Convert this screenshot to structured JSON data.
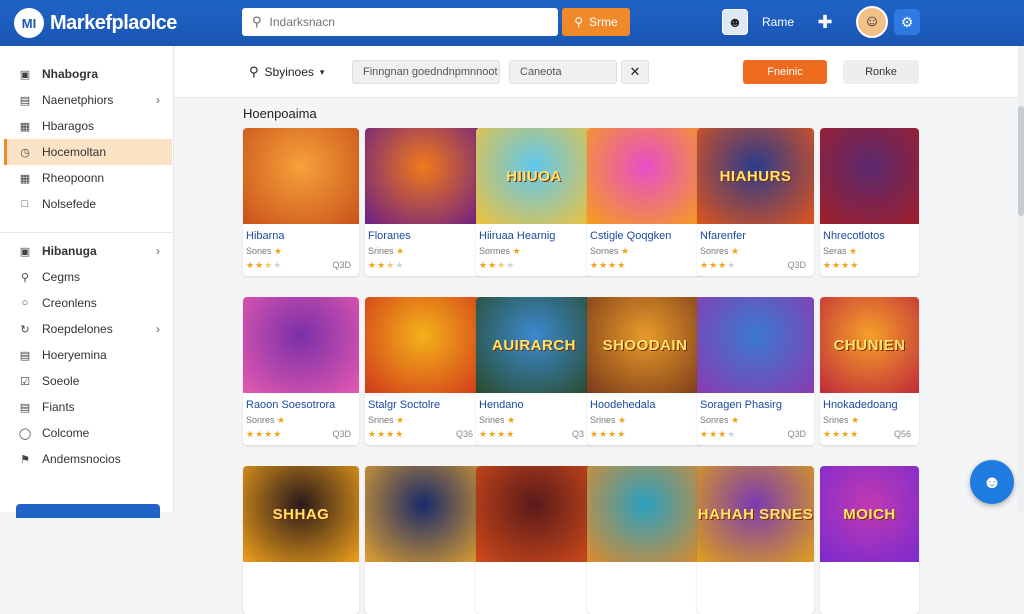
{
  "app": {
    "logo_mark": "MI",
    "name": "Markefplaolce"
  },
  "topbar": {
    "search_placeholder": "Indarksnacn",
    "search_button": "Srme",
    "user_name": "Rame",
    "plus_icon": "plus-icon",
    "settings_icon": "settings-icon"
  },
  "sidebar": {
    "group1": [
      {
        "label": "Nhabogra",
        "icon": "home-icon",
        "bold": true
      },
      {
        "label": "Naenetphiors",
        "icon": "list-icon",
        "chevron": true
      },
      {
        "label": "Hbaragos",
        "icon": "grid-icon"
      },
      {
        "label": "Hocemoltan",
        "icon": "clock-icon",
        "active": true
      },
      {
        "label": "Rheopoonn",
        "icon": "tag-icon"
      },
      {
        "label": "Nolsefede",
        "icon": "page-icon"
      }
    ],
    "group2": [
      {
        "label": "Hibanuga",
        "icon": "box-icon",
        "bold": true,
        "chevron": true
      },
      {
        "label": "Cegms",
        "icon": "search-icon"
      },
      {
        "label": "Creonlens",
        "icon": "user-icon"
      },
      {
        "label": "Roepdelones",
        "icon": "refresh-icon",
        "chevron": true
      },
      {
        "label": "Hoeryemina",
        "icon": "chat-icon"
      },
      {
        "label": "Soeole",
        "icon": "check-icon"
      },
      {
        "label": "Fiants",
        "icon": "doc-icon"
      },
      {
        "label": "Colcome",
        "icon": "circle-icon"
      },
      {
        "label": "Andemsnocios",
        "icon": "flag-icon"
      }
    ]
  },
  "filterbar": {
    "sort_label": "Sbyinoes",
    "field1": "Finngnan goedndnpmnnoot",
    "field2": "Caneota",
    "primary_button": "Fneinic",
    "secondary_button": "Ronke"
  },
  "section_title": "Hoenpoaima",
  "cards": [
    {
      "title": "Hibarna",
      "sub": "Sones",
      "rating": 2.5,
      "count": "Q3D",
      "thumb_text": "",
      "colors": [
        "#f6a23a",
        "#c9521a"
      ]
    },
    {
      "title": "Floranes",
      "sub": "Srines",
      "rating": 2.5,
      "count": "",
      "thumb_text": "",
      "colors": [
        "#f07a1a",
        "#6b1e86"
      ]
    },
    {
      "title": "Hiiruaa Hearnig",
      "sub": "Sormes",
      "rating": 2.5,
      "count": "",
      "thumb_text": "HIIUOA",
      "colors": [
        "#5ec7f0",
        "#f1c23a"
      ]
    },
    {
      "title": "Cstigle Qoqgken",
      "sub": "Sornes",
      "rating": 4,
      "count": "",
      "thumb_text": "",
      "colors": [
        "#e84ec8",
        "#f5a01a"
      ]
    },
    {
      "title": "Nfarenfer",
      "sub": "Sonres",
      "rating": 3,
      "count": "Q3D",
      "thumb_text": "HIAHURS",
      "colors": [
        "#2a3b8c",
        "#e0541b"
      ]
    },
    {
      "title": "Nhrecotlotos",
      "sub": "Seras",
      "rating": 4,
      "count": "",
      "thumb_text": "",
      "colors": [
        "#5a2a70",
        "#a01e2a"
      ]
    },
    {
      "title": "Raoon Soesotrora",
      "sub": "Sonres",
      "rating": 4,
      "count": "Q3D",
      "thumb_text": "",
      "colors": [
        "#7a2fa8",
        "#e45ab0"
      ]
    },
    {
      "title": "Stalgr Soctolre",
      "sub": "Srines",
      "rating": 4,
      "count": "Q36",
      "thumb_text": "",
      "colors": [
        "#f5b21a",
        "#d0391a"
      ]
    },
    {
      "title": "Hendano",
      "sub": "Srines",
      "rating": 4,
      "count": "Q3",
      "thumb_text": "AUIRARCH",
      "colors": [
        "#3a8ad0",
        "#2a4a2a"
      ]
    },
    {
      "title": "Hoodehedala",
      "sub": "Srines",
      "rating": 4,
      "count": "",
      "thumb_text": "SHOODAIN",
      "colors": [
        "#e89a2a",
        "#7a3a1a"
      ]
    },
    {
      "title": "Soragen Phasirg",
      "sub": "Sonres",
      "rating": 3,
      "count": "Q3D",
      "thumb_text": "",
      "colors": [
        "#3a7ad0",
        "#8a3ab0"
      ]
    },
    {
      "title": "Hnokadedoang",
      "sub": "Srines",
      "rating": 4,
      "count": "Q56",
      "thumb_text": "CHUNIEN",
      "colors": [
        "#f5a02a",
        "#c02a3a"
      ]
    },
    {
      "title": "",
      "sub": "",
      "rating": 0,
      "count": "",
      "thumb_text": "SHHAG",
      "colors": [
        "#2a1a1a",
        "#f0a01a"
      ]
    },
    {
      "title": "",
      "sub": "",
      "rating": 0,
      "count": "",
      "thumb_text": "",
      "colors": [
        "#1a2a6a",
        "#e0a030"
      ]
    },
    {
      "title": "",
      "sub": "",
      "rating": 0,
      "count": "",
      "thumb_text": "",
      "colors": [
        "#5a1a1a",
        "#d04a1a"
      ]
    },
    {
      "title": "",
      "sub": "",
      "rating": 0,
      "count": "",
      "thumb_text": "",
      "colors": [
        "#2aa0c0",
        "#e08a2a"
      ]
    },
    {
      "title": "",
      "sub": "",
      "rating": 0,
      "count": "",
      "thumb_text": "HAHAH SRNES",
      "colors": [
        "#7a3ab0",
        "#e0a01a"
      ]
    },
    {
      "title": "",
      "sub": "",
      "rating": 0,
      "count": "",
      "thumb_text": "MOICH",
      "colors": [
        "#c03ab0",
        "#7a2ad0"
      ]
    }
  ],
  "fab_icon": "chat-bot-icon"
}
